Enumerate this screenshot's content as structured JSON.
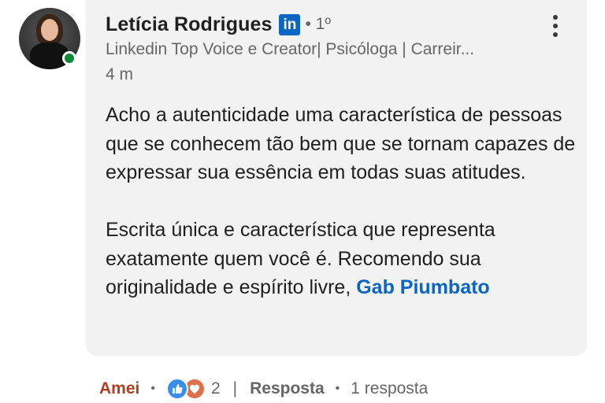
{
  "comment": {
    "author": {
      "name": "Letícia Rodrigues",
      "badge": "in",
      "degree": "• 1º",
      "headline": "Linkedin Top Voice e Creator| Psicóloga | Carreir...",
      "timestamp": "4 m",
      "online": true
    },
    "body": {
      "paragraph1": "Acho a autenticidade uma característica de pessoas que se conhecem tão bem que se tornam capazes de expressar sua essência em todas suas atitudes.",
      "paragraph2_text": "Escrita única e característica que representa exatamente quem você é.  Recomendo sua originalidade e espírito livre, ",
      "mention": "Gab Piumbato"
    },
    "more_icon": "three-dots-vertical-icon"
  },
  "actions": {
    "like_label": "Amei",
    "dot": "•",
    "reaction_count": "2",
    "reaction_icons": [
      "like-thumb-icon",
      "love-heart-icon"
    ],
    "pipe": "|",
    "reply_label": "Resposta",
    "reply_count": "1 resposta"
  },
  "colors": {
    "bubble": "#f2f2f2",
    "link": "#0a66c2",
    "amei": "#b24020",
    "online": "#0a8a3a"
  }
}
